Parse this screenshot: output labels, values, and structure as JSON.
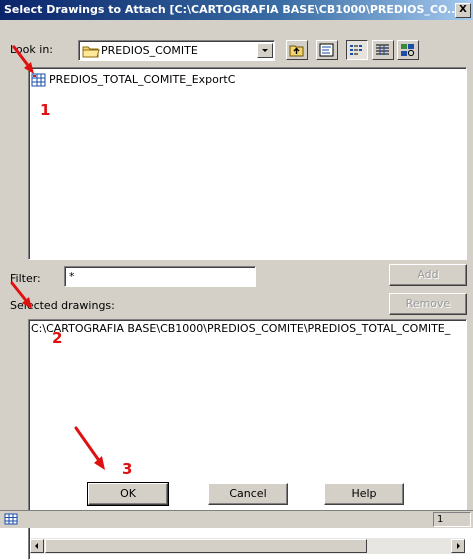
{
  "dialog": {
    "title": "Select Drawings to Attach [C:\\CARTOGRAFIA BASE\\CB1000\\PREDIOS_CO...",
    "close_glyph": "X"
  },
  "lookin": {
    "label": "Look in:",
    "value": "PREDIOS_COMITE"
  },
  "file_list": {
    "items": [
      {
        "name": "PREDIOS_TOTAL_COMITE_ExportC",
        "icon": "drawing-file-icon"
      }
    ]
  },
  "filter": {
    "label": "Filter:",
    "value": "*"
  },
  "buttons": {
    "add": "Add",
    "remove": "Remove",
    "ok": "OK",
    "cancel": "Cancel",
    "help": "Help"
  },
  "selected": {
    "label": "Selected drawings:",
    "items": [
      "C:\\CARTOGRAFIA BASE\\CB1000\\PREDIOS_COMITE\\PREDIOS_TOTAL_COMITE_"
    ]
  },
  "status": {
    "value": "1"
  },
  "annotations": {
    "markers": [
      "1",
      "2",
      "3"
    ],
    "color": "#e01010"
  },
  "colors": {
    "title_start": "#0a246a",
    "face": "#d4d0c8",
    "selection": "#0a246a"
  }
}
